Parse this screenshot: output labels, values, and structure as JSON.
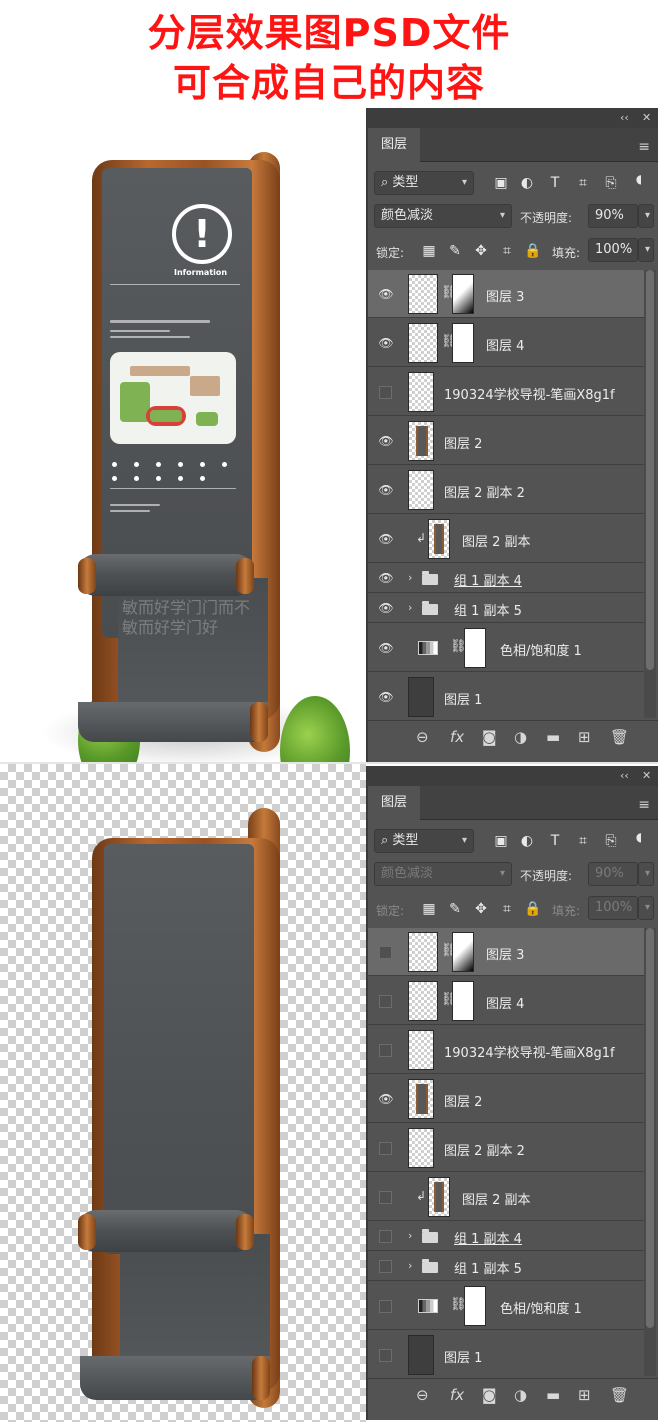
{
  "headline": {
    "line1": "分层效果图PSD文件",
    "line2": "可合成自己的内容"
  },
  "sign": {
    "info_symbol": "!",
    "info_label": "Information",
    "glyphs": "敏而好学门门而不敏而好学门好"
  },
  "panels": [
    {
      "panel_collapse": "‹‹",
      "panel_close": "✕",
      "tab": "图层",
      "filter_kind": "类型",
      "blend_mode": "颜色减淡",
      "opacity_label": "不透明度:",
      "opacity_value": "90%",
      "lock_label": "锁定:",
      "fill_label": "填充:",
      "fill_value": "100%",
      "layers": [
        {
          "name": "图层 3",
          "visible": true
        },
        {
          "name": "图层 4",
          "visible": true
        },
        {
          "name": "190324学校导视-笔画X8g1f",
          "visible": false
        },
        {
          "name": "图层 2",
          "visible": true
        },
        {
          "name": "图层 2 副本 2",
          "visible": true
        },
        {
          "name": "图层 2 副本",
          "visible": true
        },
        {
          "name": "组 1 副本 4",
          "visible": true
        },
        {
          "name": "组 1 副本 5",
          "visible": true
        },
        {
          "name": "色相/饱和度 1",
          "visible": true
        },
        {
          "name": "图层 1",
          "visible": true
        }
      ],
      "bottom_icons": [
        "link-icon",
        "fx-icon",
        "mask-icon",
        "adjustment-icon",
        "folder-icon",
        "new-layer-icon",
        "trash-icon"
      ]
    },
    {
      "panel_collapse": "‹‹",
      "panel_close": "✕",
      "tab": "图层",
      "filter_kind": "类型",
      "blend_mode": "颜色减淡",
      "opacity_label": "不透明度:",
      "opacity_value": "90%",
      "lock_label": "锁定:",
      "fill_label": "填充:",
      "fill_value": "100%",
      "layers": [
        {
          "name": "图层 3",
          "visible": false
        },
        {
          "name": "图层 4",
          "visible": false
        },
        {
          "name": "190324学校导视-笔画X8g1f",
          "visible": false
        },
        {
          "name": "图层 2",
          "visible": true
        },
        {
          "name": "图层 2 副本 2",
          "visible": false
        },
        {
          "name": "图层 2 副本",
          "visible": false
        },
        {
          "name": "组 1 副本 4",
          "visible": false
        },
        {
          "name": "组 1 副本 5",
          "visible": false
        },
        {
          "name": "色相/饱和度 1",
          "visible": false
        },
        {
          "name": "图层 1",
          "visible": false
        }
      ]
    }
  ],
  "colors": {
    "headline": "#ff1414",
    "panel_bg": "#535353",
    "selected_layer": "#6a6a6a"
  }
}
